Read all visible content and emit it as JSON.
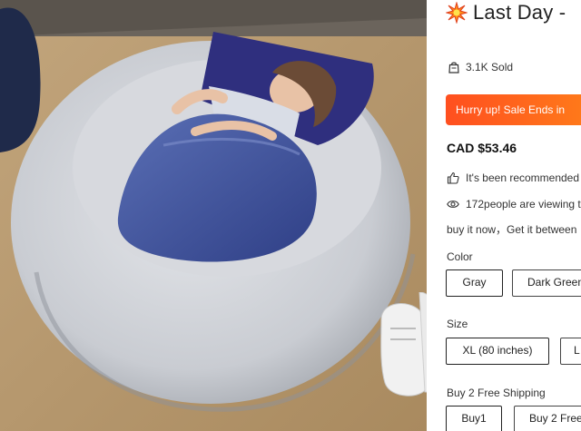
{
  "photo": {
    "alt": "Person sleeping in a large gray faux fur bean bag bed with a blue blanket",
    "icons": [
      "bean-bag-bed-image",
      "sneakers-image"
    ]
  },
  "product": {
    "title": "Last Day - ",
    "title_icon": "burst-icon",
    "sold": "3.1K Sold",
    "sold_icon": "bag-icon",
    "promo_banner": "Hurry up! Sale Ends in",
    "price": "CAD $53.46",
    "recommended": "It's been recommended",
    "recommended_icon": "thumbs-up-icon",
    "viewing": "172people are viewing t",
    "viewing_icon": "eye-icon",
    "delivery": "buy it now，Get it between"
  },
  "options": {
    "color": {
      "label": "Color",
      "values": [
        "Gray",
        "Dark Green"
      ]
    },
    "size": {
      "label": "Size",
      "values": [
        "XL (80 inches)",
        "L"
      ]
    },
    "shipping": {
      "label": "Buy 2 Free Shipping",
      "values": [
        "Buy1",
        "Buy 2 Free"
      ]
    }
  },
  "colors": {
    "accent_start": "#ff4f1f",
    "accent_end": "#ff8e17",
    "border": "#222222"
  }
}
